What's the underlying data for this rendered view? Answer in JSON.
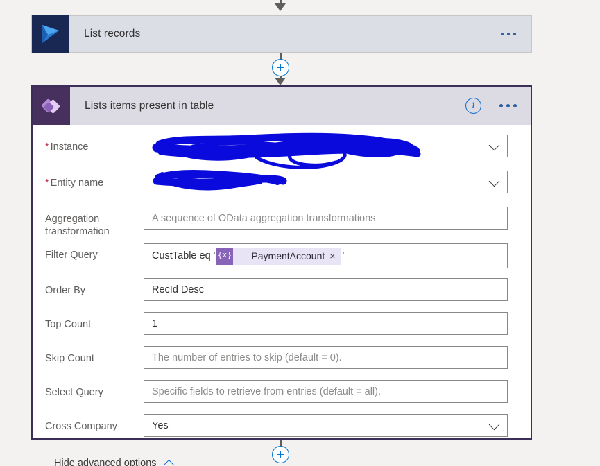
{
  "flow": {
    "collapsed_action": {
      "title": "List records",
      "icon": "dynamics365-icon",
      "overflow_label": "..."
    },
    "expanded_action": {
      "title": "Lists items present in table",
      "icon": "dataverse-icon",
      "info_label": "i",
      "overflow_label": "...",
      "advanced_toggle": "Hide advanced options"
    },
    "add_step_label": "+",
    "fields": [
      {
        "label": "Instance",
        "required": true,
        "type": "select",
        "value": "",
        "redacted": true
      },
      {
        "label": "Entity name",
        "required": true,
        "type": "select",
        "value": "",
        "redacted": true
      },
      {
        "label": "Aggregation transformation",
        "required": false,
        "type": "text",
        "value": "",
        "placeholder": "A sequence of OData aggregation transformations"
      },
      {
        "label": "Filter Query",
        "required": false,
        "type": "token",
        "prefix": "CustTable eq '",
        "token_text": "PaymentAccount",
        "token_icon": "expression-icon",
        "token_remove": "×",
        "suffix": "'"
      },
      {
        "label": "Order By",
        "required": false,
        "type": "text",
        "value": "RecId Desc",
        "placeholder": ""
      },
      {
        "label": "Top Count",
        "required": false,
        "type": "text",
        "value": "1",
        "placeholder": ""
      },
      {
        "label": "Skip Count",
        "required": false,
        "type": "text",
        "value": "",
        "placeholder": "The number of entries to skip (default = 0)."
      },
      {
        "label": "Select Query",
        "required": false,
        "type": "text",
        "value": "",
        "placeholder": "Specific fields to retrieve from entries (default = all)."
      },
      {
        "label": "Cross Company",
        "required": false,
        "type": "select",
        "value": "Yes",
        "placeholder": ""
      }
    ]
  },
  "colors": {
    "canvas": "#f3f2f1",
    "collapsed_header": "#dcdee6",
    "expanded_header": "#dcdae3",
    "selected_border": "#3b2e58",
    "d365_icon_bg": "#182852",
    "cds_icon_bg": "#472f5e",
    "accent_blue": "#0078d4",
    "required_red": "#c4314b",
    "token_bg": "#e9e4f5",
    "token_icon_bg": "#8764b8",
    "redaction_ink": "#0a0adc"
  }
}
